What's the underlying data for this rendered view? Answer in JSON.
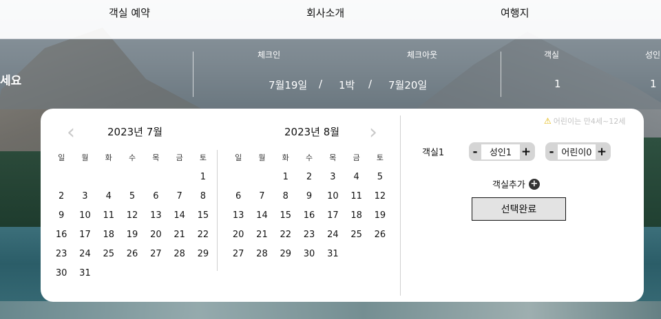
{
  "nav": {
    "items": [
      "객실 예약",
      "회사소개",
      "여행지"
    ]
  },
  "booking": {
    "prompt": "세요",
    "checkin_label": "체크인",
    "checkout_label": "체크아웃",
    "room_label": "객실",
    "adult_label": "성인",
    "checkin_value": "7월19일",
    "separator": "/",
    "nights_value": "1박",
    "checkout_value": "7월20일",
    "room_count": "1",
    "adult_count": "1"
  },
  "calendar": {
    "prev_icon": "chevron-left-icon",
    "next_icon": "chevron-right-icon",
    "weekdays": [
      "일",
      "월",
      "화",
      "수",
      "목",
      "금",
      "토"
    ],
    "months": [
      {
        "title": "2023년 7월",
        "days": [
          "",
          "",
          "",
          "",
          "",
          "",
          "1",
          "2",
          "3",
          "4",
          "5",
          "6",
          "7",
          "8",
          "9",
          "10",
          "11",
          "12",
          "13",
          "14",
          "15",
          "16",
          "17",
          "18",
          "19",
          "20",
          "21",
          "22",
          "23",
          "24",
          "25",
          "26",
          "27",
          "28",
          "29",
          "30",
          "31"
        ]
      },
      {
        "title": "2023년 8월",
        "days": [
          "",
          "",
          "1",
          "2",
          "3",
          "4",
          "5",
          "6",
          "7",
          "8",
          "9",
          "10",
          "11",
          "12",
          "13",
          "14",
          "15",
          "16",
          "17",
          "18",
          "19",
          "20",
          "21",
          "22",
          "23",
          "24",
          "25",
          "26",
          "27",
          "28",
          "29",
          "30",
          "31"
        ]
      }
    ]
  },
  "guests": {
    "notice_icon": "warning-icon",
    "notice": "어린이는 만4세~12세",
    "room_name": "객실1",
    "adult_label": "성인1",
    "child_label": "어린이0",
    "minus": "-",
    "plus": "+",
    "add_room": "객실추가",
    "add_room_icon": "plus-circle-icon",
    "done_button": "선택완료"
  }
}
